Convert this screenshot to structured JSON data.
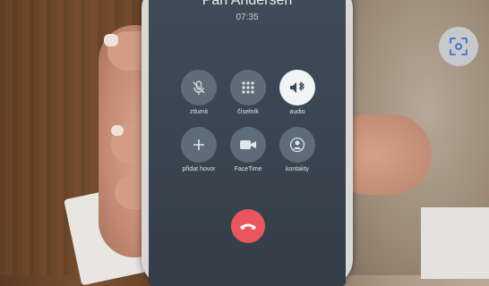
{
  "call": {
    "caller_name": "Pan Andersen",
    "duration": "07:35"
  },
  "buttons": [
    {
      "label": "ztlumit",
      "icon": "mic-off-icon"
    },
    {
      "label": "číselník",
      "icon": "keypad-icon"
    },
    {
      "label": "audio",
      "icon": "bluetooth-audio-icon",
      "active": true
    },
    {
      "label": "přidat hovor",
      "icon": "plus-icon"
    },
    {
      "label": "FaceTime",
      "icon": "facetime-icon"
    },
    {
      "label": "kontakty",
      "icon": "contacts-icon"
    }
  ],
  "end_call": {
    "icon": "end-call-icon",
    "color": "#e8565e"
  },
  "overlay": {
    "icon": "visual-search-icon"
  }
}
